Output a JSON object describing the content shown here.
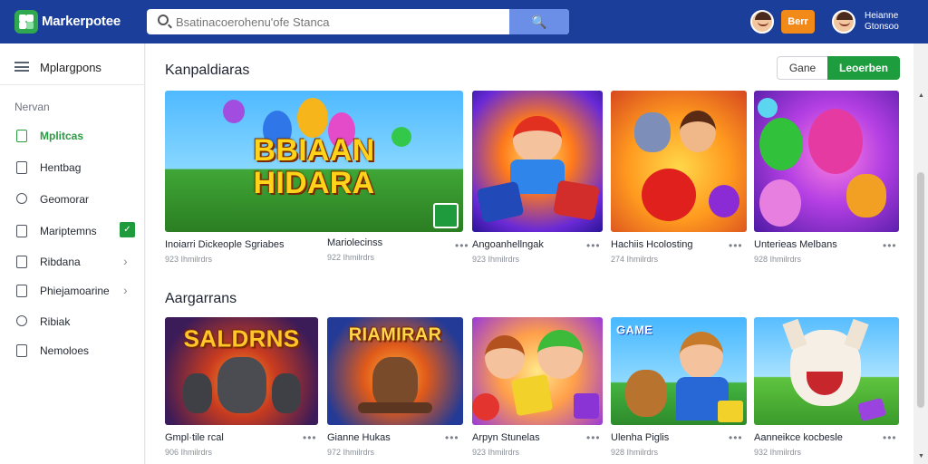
{
  "app": {
    "brand": "Markerpotee",
    "search_placeholder": "Bsatinacoerohenu'ofe Stanca",
    "search_button": "🔍",
    "order_label": "Berr",
    "user_line1": "Heianne",
    "user_line2": "Gtonsoo"
  },
  "sidebar": {
    "title": "Mplargpons",
    "section": "Nervan",
    "items": [
      {
        "label": "Mplitcas",
        "active": true,
        "badge": "✓",
        "chevron": ""
      },
      {
        "label": "Hentbag",
        "active": false,
        "badge": "",
        "chevron": ""
      },
      {
        "label": "Geomorar",
        "active": false,
        "badge": "",
        "chevron": ""
      },
      {
        "label": "Mariptemns",
        "active": false,
        "badge": "✓",
        "chevron": ""
      },
      {
        "label": "Ribdana",
        "active": false,
        "badge": "",
        "chevron": "›"
      },
      {
        "label": "Phiejamoarine",
        "active": false,
        "badge": "",
        "chevron": "›"
      },
      {
        "label": "Ribiak",
        "active": false,
        "badge": "",
        "chevron": ""
      },
      {
        "label": "Nemoloes",
        "active": false,
        "badge": "",
        "chevron": ""
      }
    ]
  },
  "main": {
    "section1_title": "Kanpaldiaras",
    "section2_title": "Aargarrans",
    "filter_secondary": "Gane",
    "filter_primary": "Leoerben",
    "more_label": "•••",
    "row1": [
      {
        "name": "Inoiarri Dickeople Sgriabes",
        "meta": "923 Ihmilrdrs",
        "thumb_title": "BBIAAN HIDARA"
      },
      {
        "name": "Mariolecinss",
        "meta": "922 Ihmilrdrs",
        "thumb_title": ""
      },
      {
        "name": "Angoanhellngak",
        "meta": "923 Ihmilrdrs",
        "thumb_title": ""
      },
      {
        "name": "Hachiis Hcolosting",
        "meta": "274 Ihmilrdrs",
        "thumb_title": ""
      },
      {
        "name": "Unterieas Melbans",
        "meta": "928 Ihmilrdrs",
        "thumb_title": ""
      }
    ],
    "row2": [
      {
        "name": "Gmpl·tile rcal",
        "meta": "906 Ihmilrdrs",
        "thumb_title": "SALDRNS"
      },
      {
        "name": "Gianne Hukas",
        "meta": "972 Ihmilrdrs",
        "thumb_title": "RIAMIRAR"
      },
      {
        "name": "Arpyn Stunelas",
        "meta": "923 Ihmilrdrs",
        "thumb_title": ""
      },
      {
        "name": "Ulenha Piglis",
        "meta": "928 Ihmilrdrs",
        "thumb_title": "GAME"
      },
      {
        "name": "Aanneikce kocbesle",
        "meta": "932 Ihmilrdrs",
        "thumb_title": ""
      }
    ]
  }
}
